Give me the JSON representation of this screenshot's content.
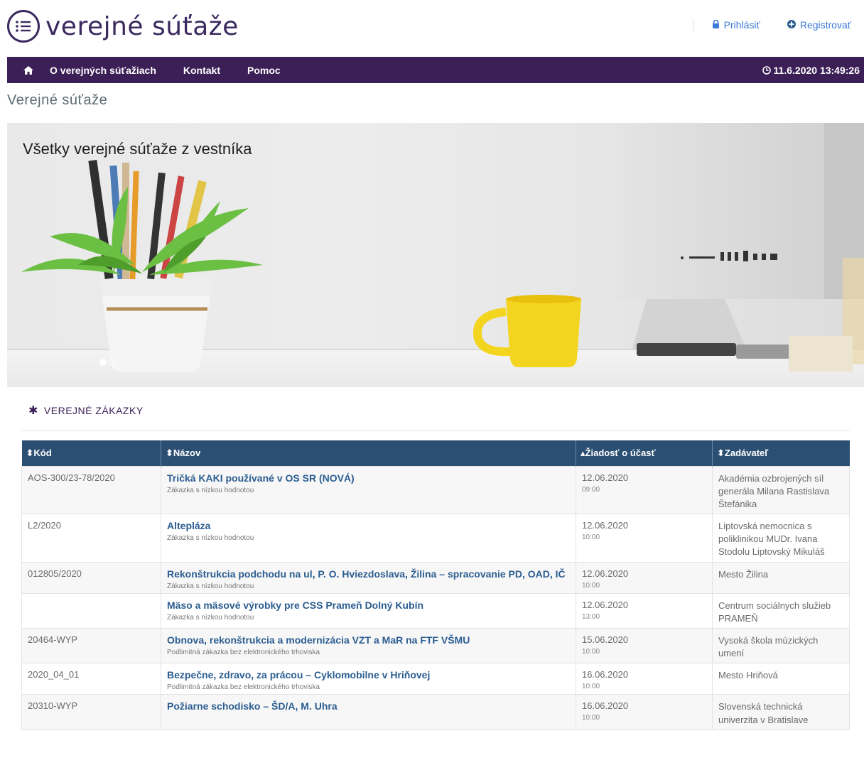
{
  "header": {
    "logo_text": "verejné súťaže",
    "login_label": "Prihlásiť",
    "register_label": "Registrovať"
  },
  "nav": {
    "items": [
      "O verejných súťažiach",
      "Kontakt",
      "Pomoc"
    ],
    "datetime": "11.6.2020 13:49:26"
  },
  "page_title": "Verejné súťaže",
  "hero": {
    "title": "Všetky verejné súťaže z vestníka",
    "slides": 2,
    "active_slide": 1
  },
  "section": {
    "title": "VEREJNÉ ZÁKAZKY"
  },
  "table": {
    "headers": [
      "Kód",
      "Názov",
      "Žiadosť o účasť",
      "Zadávateľ"
    ],
    "rows": [
      {
        "kod": "AOS-300/23-78/2020",
        "nazov": "Tričká KAKI používané v OS SR (NOVÁ)",
        "typ": "Zákazka s nízkou hodnotou",
        "datum": "12.06.2020",
        "cas": "09:00",
        "zadavatel": "Akadémia ozbrojených síl generála Milana Rastislava Štefánika"
      },
      {
        "kod": "L2/2020",
        "nazov": "Altepláza",
        "typ": "Zákazka s nízkou hodnotou",
        "datum": "12.06.2020",
        "cas": "10:00",
        "zadavatel": "Liptovská nemocnica s poliklinikou MUDr. Ivana Stodolu Liptovský Mikuláš"
      },
      {
        "kod": "012805/2020",
        "nazov": "Rekonštrukcia podchodu na ul, P. O. Hviezdoslava, Žilina – spracovanie PD, OAD, IČ",
        "typ": "Zákazka s nízkou hodnotou",
        "datum": "12.06.2020",
        "cas": "10:00",
        "zadavatel": "Mesto Žilina"
      },
      {
        "kod": "",
        "nazov": "Mäso a mäsové výrobky pre CSS Prameň Dolný Kubín",
        "typ": "Zákazka s nízkou hodnotou",
        "datum": "12.06.2020",
        "cas": "13:00",
        "zadavatel": "Centrum sociálnych služieb PRAMEŇ"
      },
      {
        "kod": "20464-WYP",
        "nazov": "Obnova, rekonštrukcia a modernizácia VZT a MaR na FTF VŠMU",
        "typ": "Podlimitná zákazka bez elektronického trhoviska",
        "datum": "15.06.2020",
        "cas": "10:00",
        "zadavatel": "Vysoká škola múzických umení"
      },
      {
        "kod": "2020_04_01",
        "nazov": "Bezpečne, zdravo, za prácou – Cyklomobilne v Hriňovej",
        "typ": "Podlimitná zákazka bez elektronického trhoviska",
        "datum": "16.06.2020",
        "cas": "10:00",
        "zadavatel": "Mesto Hriňová"
      },
      {
        "kod": "20310-WYP",
        "nazov": "Požiarne schodisko – ŠD/A, M. Uhra",
        "typ": "",
        "datum": "16.06.2020",
        "cas": "10:00",
        "zadavatel": "Slovenská technická univerzita v Bratislave"
      }
    ]
  }
}
